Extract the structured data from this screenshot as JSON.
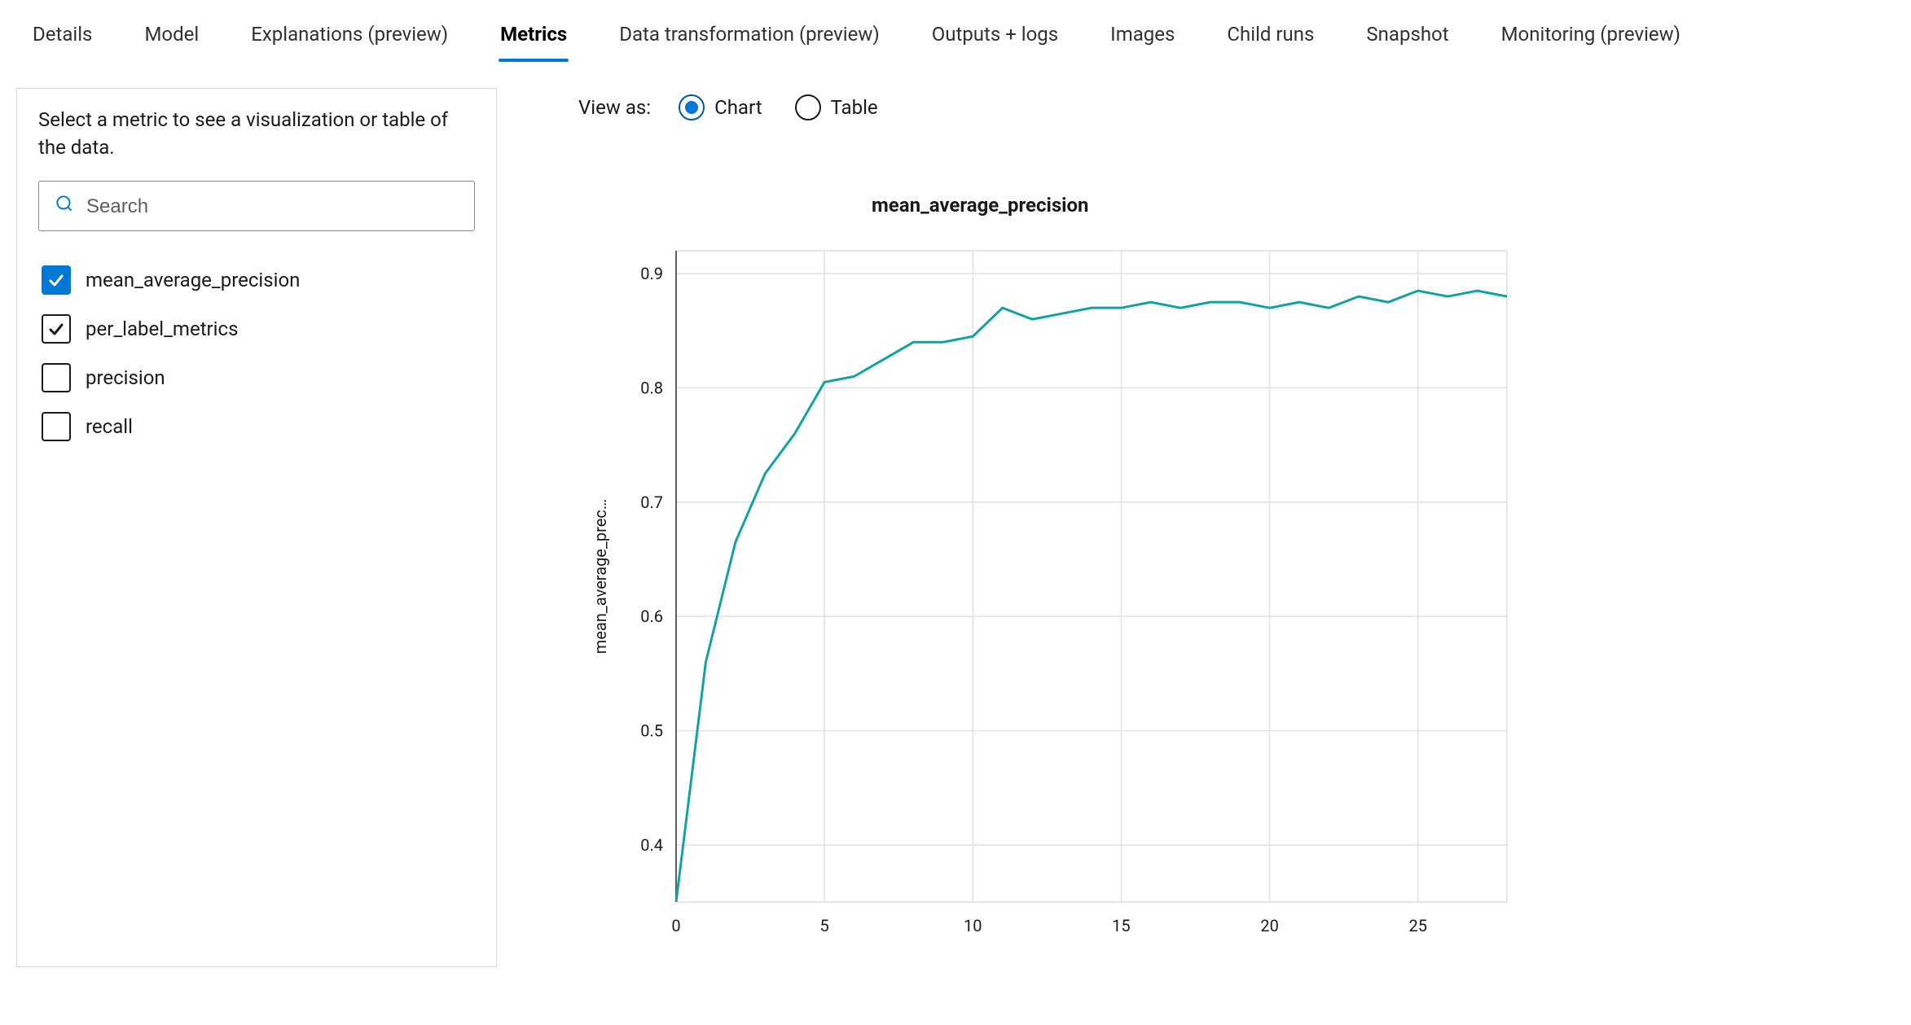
{
  "tabs": [
    {
      "label": "Details",
      "selected": false
    },
    {
      "label": "Model",
      "selected": false
    },
    {
      "label": "Explanations (preview)",
      "selected": false
    },
    {
      "label": "Metrics",
      "selected": true
    },
    {
      "label": "Data transformation (preview)",
      "selected": false
    },
    {
      "label": "Outputs + logs",
      "selected": false
    },
    {
      "label": "Images",
      "selected": false
    },
    {
      "label": "Child runs",
      "selected": false
    },
    {
      "label": "Snapshot",
      "selected": false
    },
    {
      "label": "Monitoring (preview)",
      "selected": false
    }
  ],
  "sidebar": {
    "hint": "Select a metric to see a visualization or table of the data.",
    "search_placeholder": "Search",
    "metrics": [
      {
        "label": "mean_average_precision",
        "state": "checked-primary"
      },
      {
        "label": "per_label_metrics",
        "state": "checked-outline"
      },
      {
        "label": "precision",
        "state": "unchecked"
      },
      {
        "label": "recall",
        "state": "unchecked"
      }
    ]
  },
  "viewas": {
    "label": "View as:",
    "options": [
      {
        "label": "Chart",
        "selected": true
      },
      {
        "label": "Table",
        "selected": false
      }
    ]
  },
  "chart_data": {
    "type": "line",
    "title": "mean_average_precision",
    "xlabel": "",
    "ylabel": "mean_average_prec…",
    "ylim": [
      0.35,
      0.92
    ],
    "y_ticks": [
      0.4,
      0.5,
      0.6,
      0.7,
      0.8,
      0.9
    ],
    "x_ticks": [
      0,
      5,
      10,
      15,
      20,
      25
    ],
    "xlim": [
      0,
      28
    ],
    "x": [
      0,
      1,
      2,
      3,
      4,
      5,
      6,
      7,
      8,
      9,
      10,
      11,
      12,
      13,
      14,
      15,
      16,
      17,
      18,
      19,
      20,
      21,
      22,
      23,
      24,
      25,
      26,
      27,
      28
    ],
    "values": [
      0.35,
      0.56,
      0.665,
      0.725,
      0.76,
      0.805,
      0.81,
      0.825,
      0.84,
      0.84,
      0.845,
      0.87,
      0.86,
      0.865,
      0.87,
      0.87,
      0.875,
      0.87,
      0.875,
      0.875,
      0.87,
      0.875,
      0.87,
      0.88,
      0.875,
      0.885,
      0.88,
      0.885,
      0.88
    ],
    "series_color": "#14a2a0"
  }
}
